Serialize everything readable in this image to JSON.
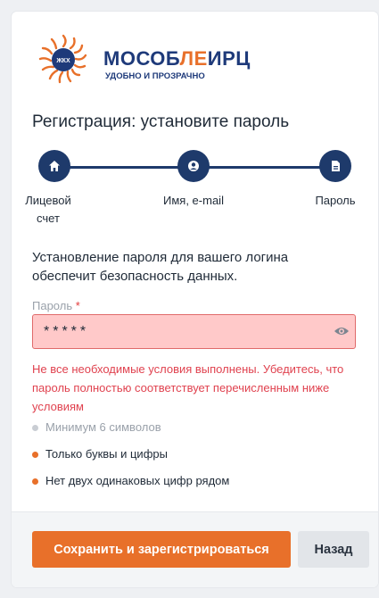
{
  "brand": {
    "name_part1": "МОСОБ",
    "name_part2": "ЛЕ",
    "name_part3": "ИРЦ",
    "tagline": "УДОБНО И ПРОЗРАЧНО",
    "badge": "ЖКХ",
    "colors": {
      "navy": "#1e3a7a",
      "orange": "#e8702a"
    }
  },
  "page": {
    "title": "Регистрация: установите пароль",
    "info": "Установление пароля для вашего логина обеспечит безопасность данных."
  },
  "stepper": {
    "steps": [
      {
        "icon": "home-icon",
        "label_line1": "Лицевой",
        "label_line2": "счет"
      },
      {
        "icon": "user-icon",
        "label": "Имя, e-mail"
      },
      {
        "icon": "document-icon",
        "label": "Пароль"
      }
    ]
  },
  "password": {
    "label": "Пароль",
    "required_mark": "*",
    "value": "*****",
    "toggle_icon": "eye-icon"
  },
  "error": "Не все необходимые условия выполнены. Убедитесь, что пароль полностью соответствует перечисленным ниже условиям",
  "conditions": [
    {
      "text": "Минимум 6 символов",
      "status": "muted"
    },
    {
      "text": "Только буквы и цифры",
      "status": "warning"
    },
    {
      "text": "Нет двух одинаковых цифр рядом",
      "status": "warning"
    }
  ],
  "actions": {
    "submit_label": "Сохранить и зарегистрироваться",
    "back_label": "Назад"
  }
}
